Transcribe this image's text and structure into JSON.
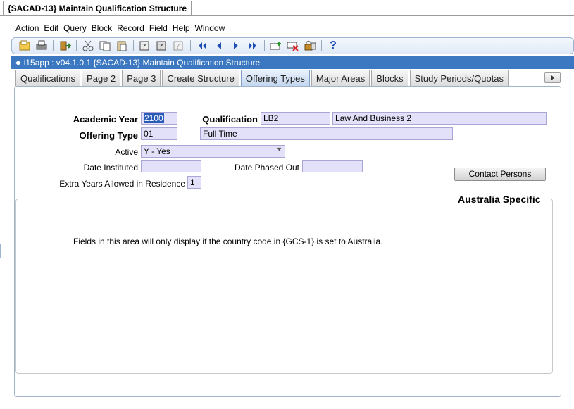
{
  "window": {
    "title": "{SACAD-13} Maintain Qualification Structure"
  },
  "menu": [
    {
      "u": "A",
      "rest": "ction"
    },
    {
      "u": "E",
      "rest": "dit"
    },
    {
      "u": "Q",
      "rest": "uery"
    },
    {
      "u": "B",
      "rest": "lock"
    },
    {
      "u": "R",
      "rest": "ecord"
    },
    {
      "u": "F",
      "rest": "ield"
    },
    {
      "u": "H",
      "rest": "elp"
    },
    {
      "u": "W",
      "rest": "indow"
    }
  ],
  "toolbar": {
    "icons": [
      "save-icon",
      "print-icon",
      "exit-icon",
      "cut-icon",
      "copy-icon",
      "paste-icon",
      "enter-query-icon",
      "execute-query-icon",
      "cancel-query-icon",
      "first-record-icon",
      "previous-record-icon",
      "next-record-icon",
      "last-record-icon",
      "insert-record-icon",
      "delete-record-icon",
      "lock-record-icon",
      "help-icon"
    ],
    "help_symbol": "?"
  },
  "appbar": {
    "title": "i15app : v04.1.0.1  {SACAD-13} Maintain Qualification Structure"
  },
  "tabs": [
    {
      "label": "Qualifications",
      "active": false
    },
    {
      "label": "Page 2",
      "active": false
    },
    {
      "label": "Page 3",
      "active": false
    },
    {
      "label": "Create Structure",
      "active": false
    },
    {
      "label": "Offering Types",
      "active": true
    },
    {
      "label": "Major Areas",
      "active": false
    },
    {
      "label": "Blocks",
      "active": false
    },
    {
      "label": "Study Periods/Quotas",
      "active": false
    }
  ],
  "form": {
    "academic_year_label": "Academic Year",
    "academic_year_value": "2100",
    "qualification_label": "Qualification",
    "qualification_code": "LB2",
    "qualification_name": "Law And Business 2",
    "offering_type_label": "Offering Type",
    "offering_type_code": "01",
    "offering_type_name": "Full Time",
    "active_label": "Active",
    "active_value": "Y - Yes",
    "date_instituted_label": "Date Instituted",
    "date_instituted_value": "",
    "date_phased_out_label": "Date Phased Out",
    "date_phased_out_value": "",
    "extra_years_label": "Extra Years Allowed in Residence",
    "extra_years_value": "1",
    "contact_persons_button": "Contact Persons"
  },
  "australia": {
    "title": "Australia Specific",
    "info": "Fields in this area will only display if the country code in {GCS-1} is set to Australia."
  },
  "colors": {
    "appbar": "#3b78c1",
    "field_bg": "#e3e1fa",
    "active_tab": "#c4d7ef"
  }
}
